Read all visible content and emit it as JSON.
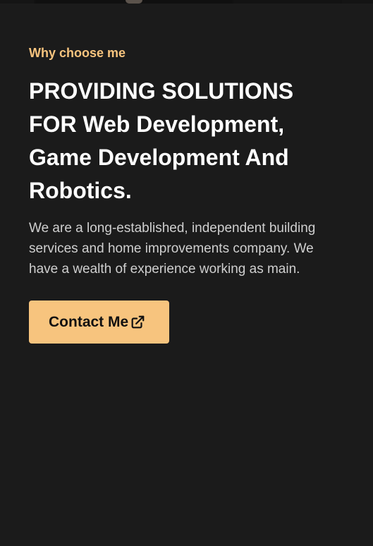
{
  "hero": {
    "eyebrow": "Why choose me",
    "headline": "PROVIDING SOLUTIONS FOR Web Development, Game Development And Robotics.",
    "description": "We are a long-established, independent building services and home improvements company. We have a wealth of experience working as main.",
    "cta_label": "Contact Me",
    "cta_icon": "external-link-icon"
  },
  "colors": {
    "background": "#1b1b1b",
    "accent": "#f7c47e",
    "heading": "#ffffff",
    "body_text": "#cfcfcf"
  }
}
